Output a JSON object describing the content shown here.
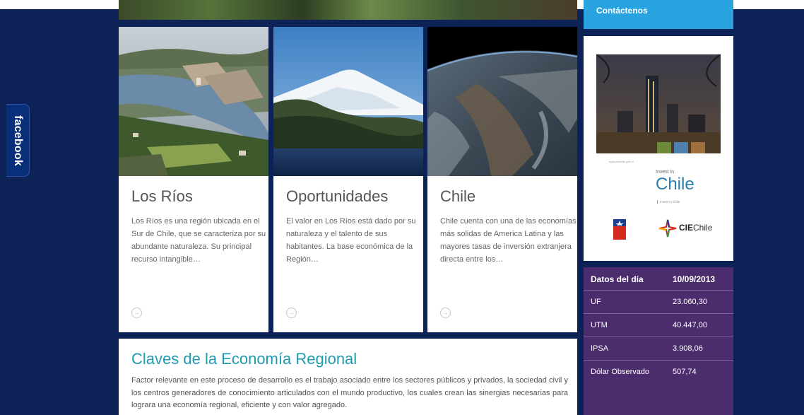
{
  "header": {
    "contact_label": "Contáctenos"
  },
  "facebook_tab": {
    "label": "facebook"
  },
  "cards": [
    {
      "title": "Los Ríos",
      "text": "Los Ríos es una región ubicada en el Sur de Chile, que se caracteriza por su abundante naturaleza. Su principal recurso intangible…",
      "photo": "river-town-aerial-photo",
      "arrow_icon": "arrow-circle-icon"
    },
    {
      "title": "Oportunidades",
      "text": "El valor en Los Ríos está dado por su naturaleza y el talento de sus habitantes. La base económica de la Región…",
      "photo": "snowy-volcano-lake-photo",
      "arrow_icon": "arrow-circle-icon"
    },
    {
      "title": "Chile",
      "text": "Chile cuenta con una de las economías más solidas de America Latina y las mayores tasas de inversión extranjera directa entre los…",
      "photo": "chile-from-space-photo",
      "arrow_icon": "arrow-circle-icon"
    }
  ],
  "claves": {
    "title": "Claves de la Economía Regional",
    "text": "Factor relevante en este proceso de desarrollo es el trabajo asociado entre los sectores públicos y privados, la sociedad civil y los centros generadores de conocimiento articulados con el mundo productivo, los cuales crean las sinergias necesarias para lograra una economía regional, eficiente y con valor agregado."
  },
  "ad": {
    "url": "www.ciechile.gob.cl",
    "invest_in": "Invest in",
    "chile": "Chile",
    "sub": "Invest in Chile",
    "cie_strong": "CIE",
    "cie_rest": "Chile"
  },
  "datos": {
    "header_label": "Datos del día",
    "date": "10/09/2013",
    "rows": [
      {
        "label": "UF",
        "value": "23.060,30"
      },
      {
        "label": "UTM",
        "value": "40.447,00"
      },
      {
        "label": "IPSA",
        "value": "3.908,06"
      },
      {
        "label": "Dólar Observado",
        "value": "507,74"
      }
    ]
  },
  "colors": {
    "background": "#0d2357",
    "contact_bar": "#29a3e0",
    "datos_panel": "#4b2d6e",
    "claves_title": "#1f9bb0",
    "facebook_tab": "#0a2f7a"
  }
}
